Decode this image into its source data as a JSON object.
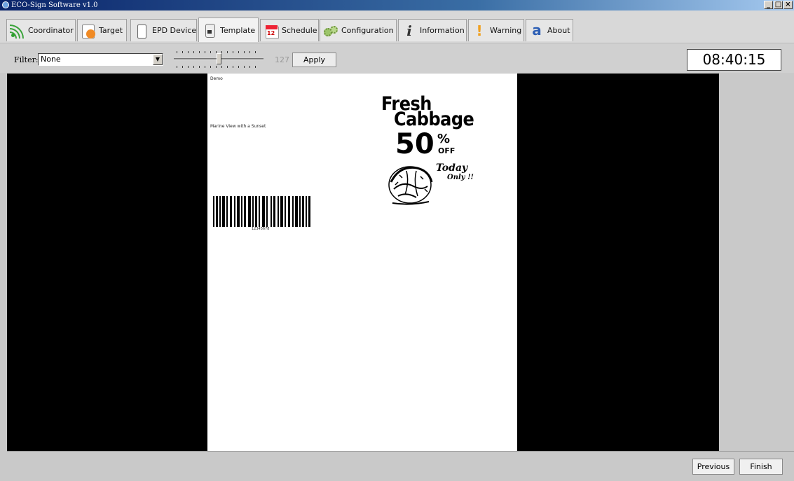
{
  "window": {
    "title": "ECO-Sign Software v1.0",
    "controls": [
      "_",
      "□",
      "×"
    ]
  },
  "tabs": [
    {
      "label": "Coordinator",
      "icon": "signal-icon"
    },
    {
      "label": "Target",
      "icon": "target-icon"
    },
    {
      "label": "EPD Device",
      "icon": "device-icon"
    },
    {
      "label": "Template",
      "icon": "template-icon",
      "active": true
    },
    {
      "label": "Schedule",
      "icon": "calendar-icon"
    },
    {
      "label": "Configuration",
      "icon": "gears-icon"
    },
    {
      "label": "Information",
      "icon": "info-icon"
    },
    {
      "label": "Warning",
      "icon": "warning-icon"
    },
    {
      "label": "About",
      "icon": "about-icon"
    }
  ],
  "toolbar": {
    "filter_label": "Filter:",
    "filter_value": "None",
    "slider_value": "127",
    "slider_level": 0.5,
    "apply_label": "Apply",
    "clock": "08:40:15"
  },
  "preview": {
    "demo_label": "Demo",
    "marine_label": "Marine View with a Sunset",
    "barcode_number": "12345678",
    "poster": {
      "line1": "Fresh",
      "line2": "Cabbage",
      "discount": "50",
      "percent": "%",
      "off": "OFF",
      "today": "Today",
      "only": "Only !!"
    }
  },
  "footer": {
    "previous_label": "Previous",
    "finish_label": "Finish"
  },
  "colors": {
    "titlebar": "#0a246a",
    "canvas_bg": "#000000",
    "page_bg": "#ffffff",
    "workspace_bg": "#c9c9c9"
  }
}
